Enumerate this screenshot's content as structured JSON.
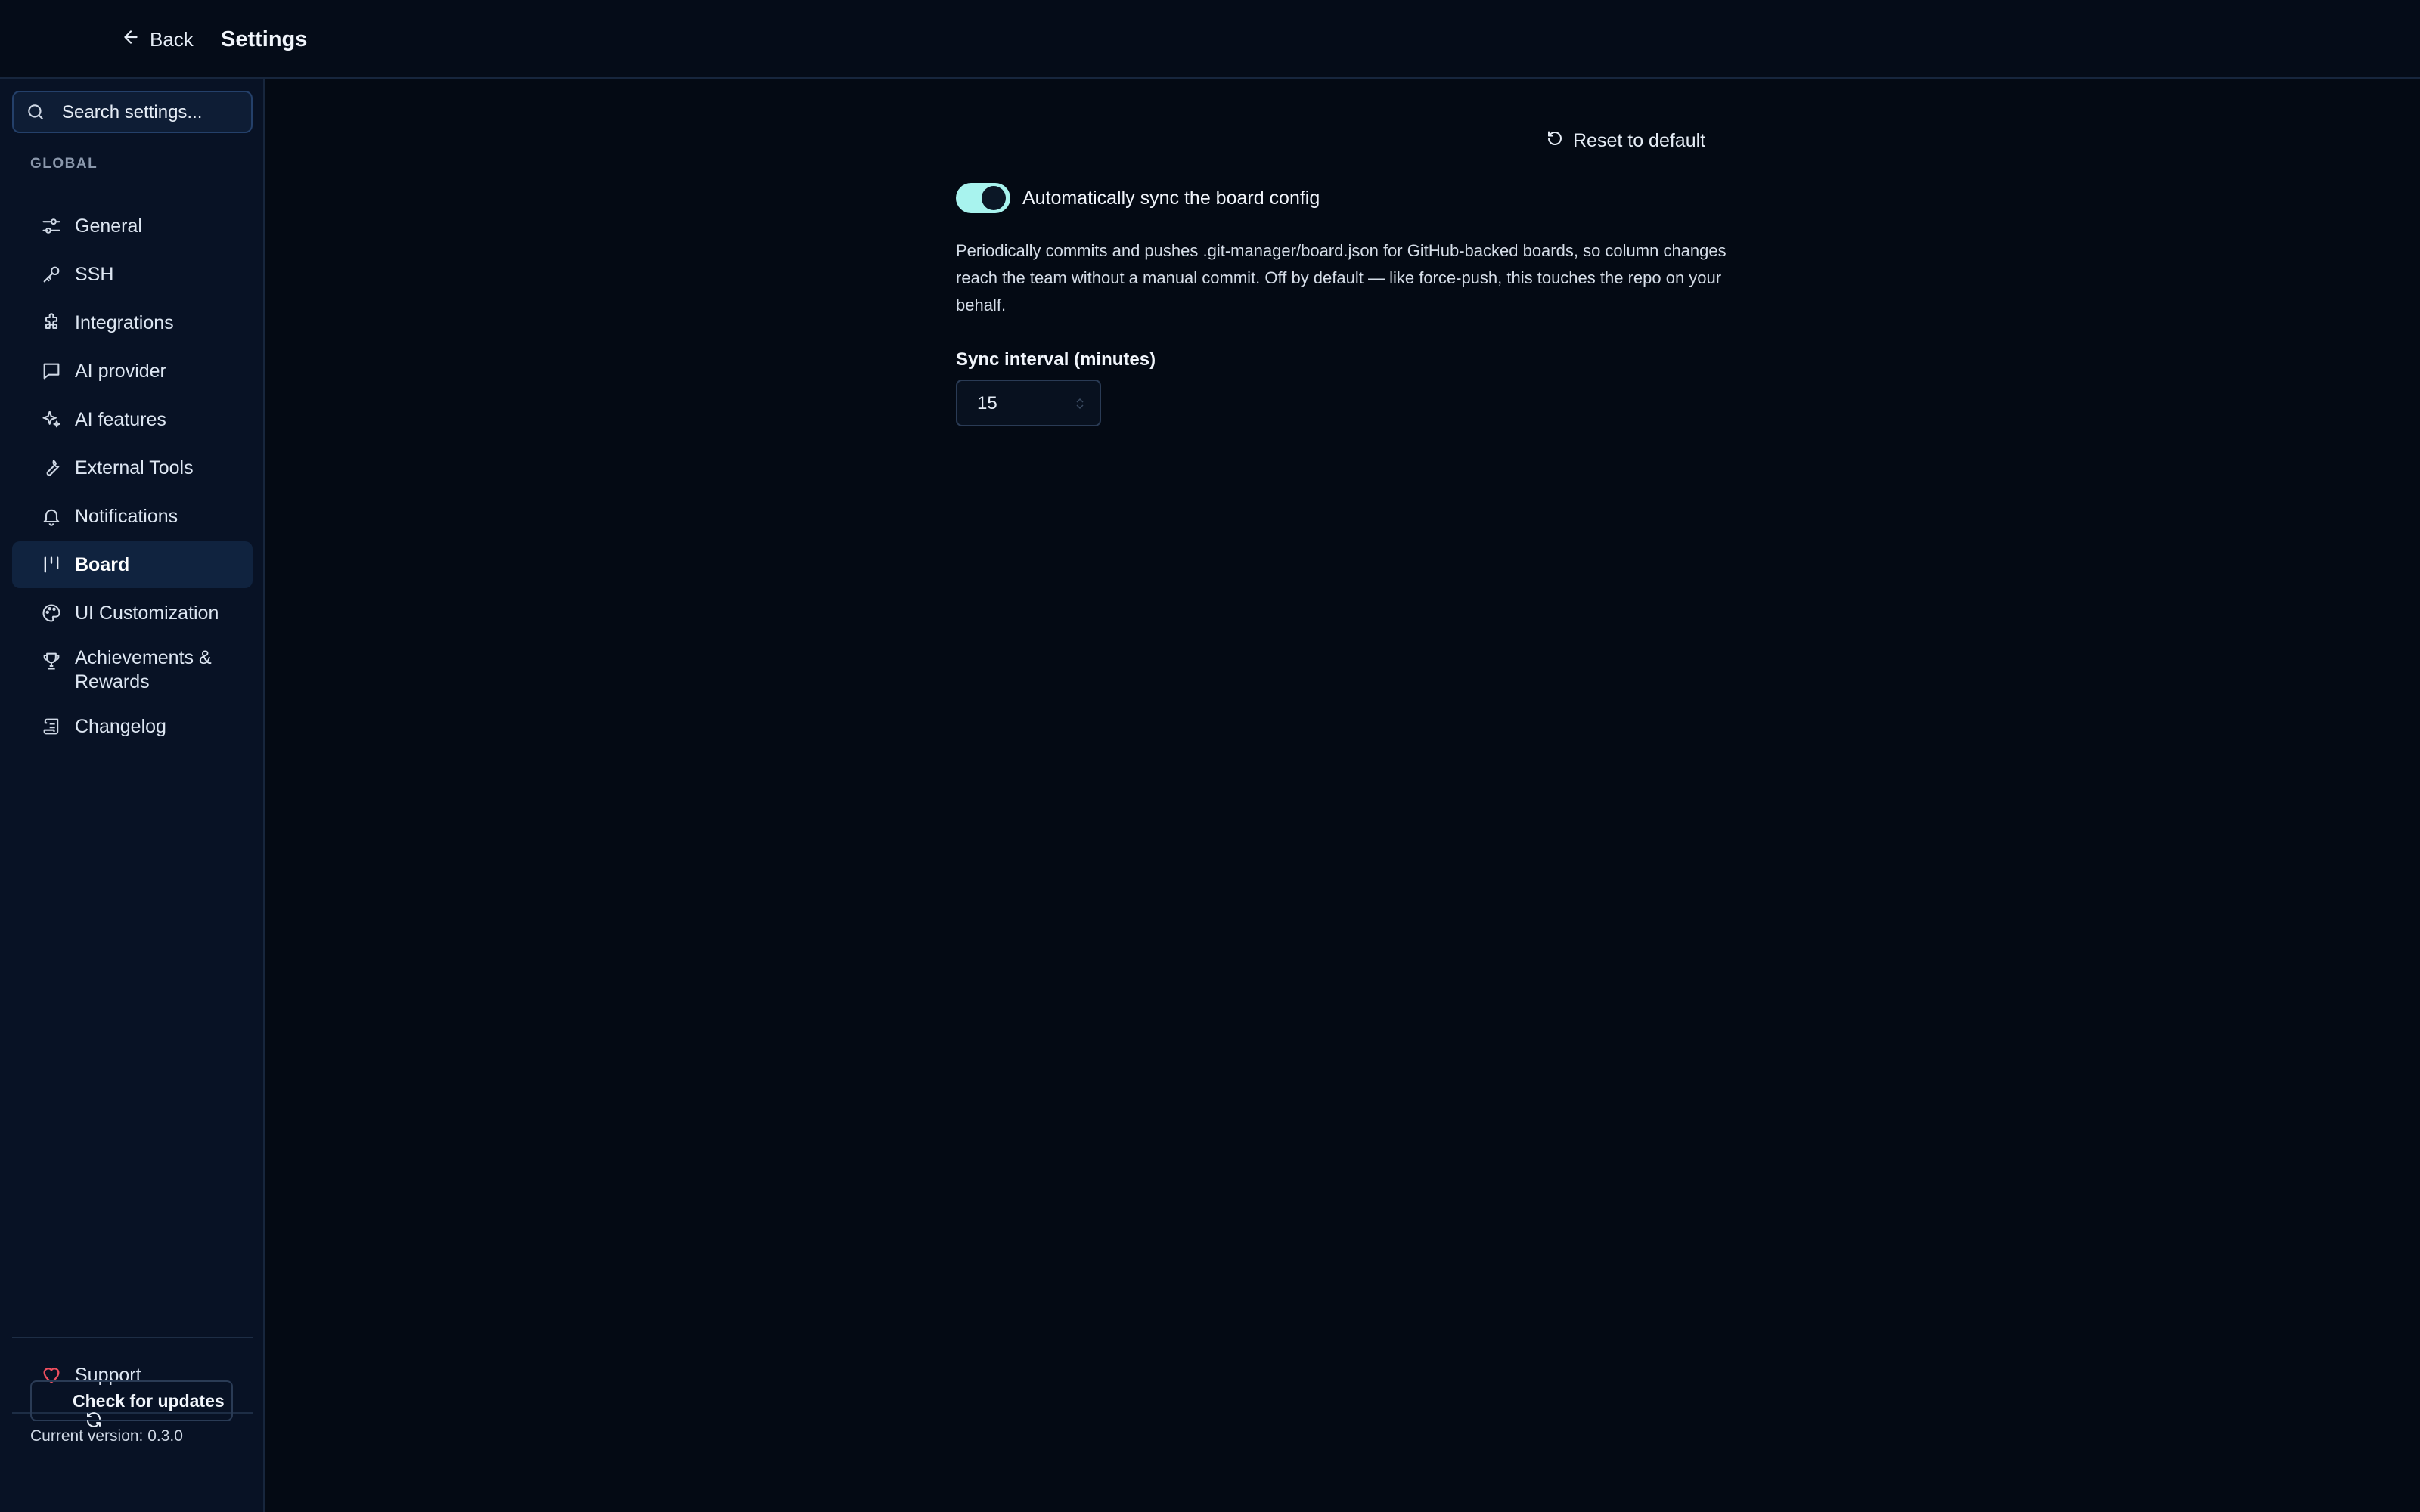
{
  "header": {
    "back_label": "Back",
    "title": "Settings"
  },
  "sidebar": {
    "search_placeholder": "Search settings...",
    "section_label": "GLOBAL",
    "items": [
      {
        "label": "General",
        "icon": "sliders-icon"
      },
      {
        "label": "SSH",
        "icon": "key-icon"
      },
      {
        "label": "Integrations",
        "icon": "puzzle-icon"
      },
      {
        "label": "AI provider",
        "icon": "message-icon"
      },
      {
        "label": "AI features",
        "icon": "sparkles-icon"
      },
      {
        "label": "External Tools",
        "icon": "wrench-icon"
      },
      {
        "label": "Notifications",
        "icon": "bell-icon"
      },
      {
        "label": "Board",
        "icon": "kanban-icon",
        "active": true
      },
      {
        "label": "UI Customization",
        "icon": "palette-icon"
      },
      {
        "label": "Achievements & Rewards",
        "icon": "trophy-icon"
      },
      {
        "label": "Changelog",
        "icon": "scroll-icon"
      }
    ],
    "support_label": "Support",
    "version_text": "Current version: 0.3.0",
    "check_updates_label": "Check for updates"
  },
  "main": {
    "reset_label": "Reset to default",
    "auto_sync": {
      "enabled": true,
      "label": "Automatically sync the board config",
      "description": "Periodically commits and pushes .git-manager/board.json for GitHub-backed boards, so column changes reach the team without a manual commit. Off by default — like force-push, this touches the repo on your behalf."
    },
    "sync_interval": {
      "label": "Sync interval (minutes)",
      "value": "15"
    }
  },
  "colors": {
    "background": "#040a14",
    "sidebar": "#081225",
    "toggle_on": "#a8f3ee",
    "support_heart": "#ef4f5f"
  }
}
